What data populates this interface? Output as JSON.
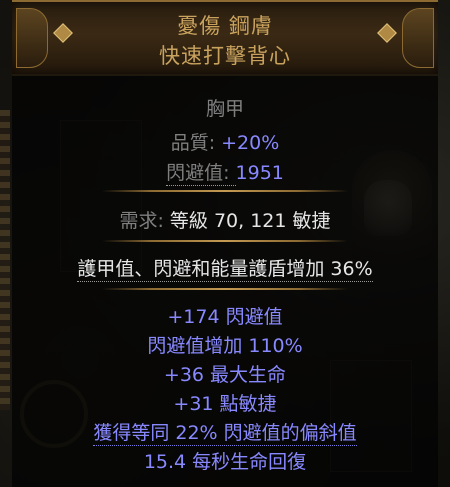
{
  "item": {
    "name_line1": "憂傷 鋼膚",
    "name_line2": "快速打擊背心",
    "item_class": "胸甲"
  },
  "properties": [
    {
      "label": "品質: ",
      "value": "+20%"
    },
    {
      "label": "閃避值: ",
      "value": "1951"
    }
  ],
  "requirements": {
    "label": "需求: ",
    "text": "等級 70, 121 敏捷"
  },
  "enchant": "護甲值、閃避和能量護盾增加 36%",
  "mods": [
    "+174 閃避值",
    "閃避值增加 110%",
    "+36 最大生命",
    "+31 點敏捷",
    "獲得等同 22% 閃避值的偏斜值",
    "15.4 每秒生命回復"
  ],
  "colors": {
    "unique_name": "#c9a35e",
    "magic_mod": "#8888ff",
    "label_gray": "#7f7f7f",
    "text_white": "#e6e6e6"
  }
}
